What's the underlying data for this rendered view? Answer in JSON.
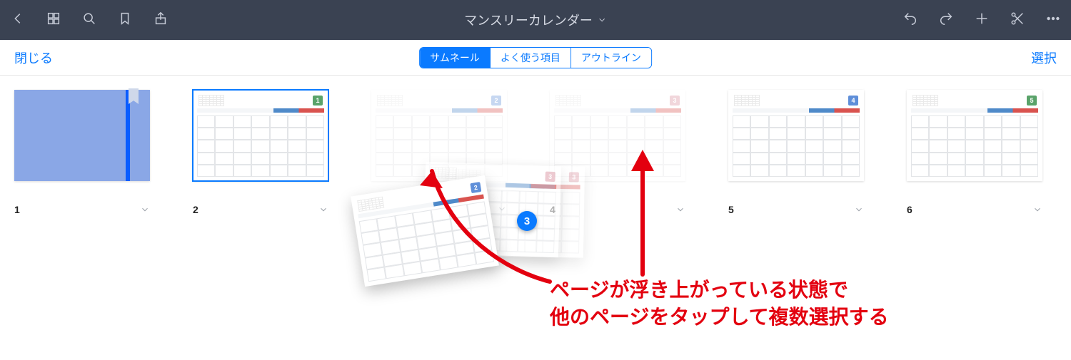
{
  "topbar": {
    "title": "マンスリーカレンダー"
  },
  "secondbar": {
    "close_label": "閉じる",
    "select_label": "選択",
    "segments": {
      "thumbnail": "サムネール",
      "favorites": "よく使う項目",
      "outline": "アウトライン"
    }
  },
  "thumbs": [
    {
      "num": "1",
      "kind": "cover"
    },
    {
      "num": "2",
      "kind": "cal",
      "month": "1",
      "color": "#5aa36a",
      "selected": true
    },
    {
      "num": "",
      "kind": "cal",
      "month": "2",
      "color": "#5f8fd9",
      "faded": true
    },
    {
      "num": "4",
      "kind": "cal",
      "month": "3",
      "color": "#d98c9a",
      "faded": true
    },
    {
      "num": "5",
      "kind": "cal",
      "month": "4",
      "color": "#5f8fd9"
    },
    {
      "num": "6",
      "kind": "cal",
      "month": "5",
      "color": "#5aa36a"
    }
  ],
  "drag": {
    "count": "3",
    "front_month": "2",
    "front_color": "#5f8fd9",
    "back_month": "3",
    "back_color": "#d98c9a"
  },
  "annotation": {
    "line1": "ページが浮き上がっている状態で",
    "line2": "他のページをタップして複数選択する"
  }
}
